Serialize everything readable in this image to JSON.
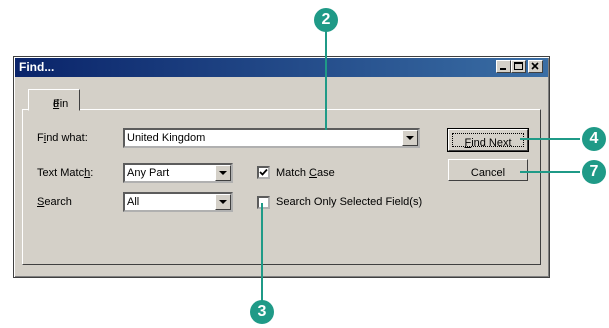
{
  "window": {
    "title": "Find..."
  },
  "tabs": [
    {
      "label_pre": "Fin",
      "label_u": "d",
      "label_post": ""
    }
  ],
  "find_what": {
    "label_pre": "F",
    "label_u": "i",
    "label_post": "nd what:",
    "value": "United Kingdom"
  },
  "text_match": {
    "label_pre": "Text Matc",
    "label_u": "h",
    "label_post": ":",
    "value": "Any Part"
  },
  "search": {
    "label_pre": "",
    "label_u": "S",
    "label_post": "earch",
    "value": "All"
  },
  "match_case": {
    "label_pre": "Match ",
    "label_u": "C",
    "label_post": "ase",
    "checked": true
  },
  "search_selected": {
    "label": "Search Only Selected Field(s)",
    "checked": false
  },
  "buttons": {
    "find_next_pre": "",
    "find_next_u": "F",
    "find_next_post": "ind Next",
    "cancel": "Cancel"
  },
  "callouts": {
    "c2": "2",
    "c3": "3",
    "c4": "4",
    "c7": "7"
  },
  "colors": {
    "callout": "#1f9a87",
    "titlebar_start": "#0a246a",
    "titlebar_end": "#3a6ea5",
    "face": "#d4d0c8"
  }
}
